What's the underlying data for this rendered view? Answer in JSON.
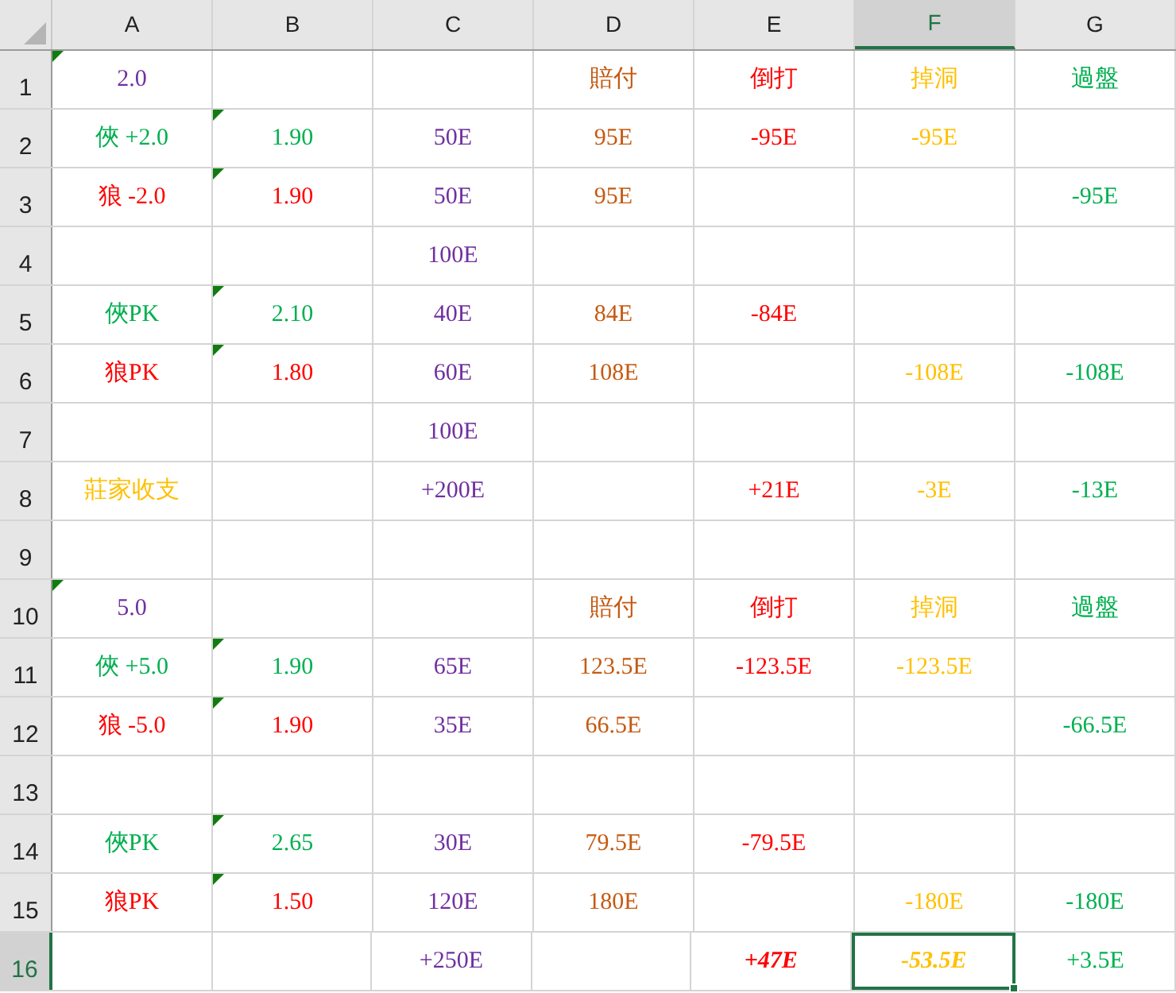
{
  "columns": [
    {
      "label": "A",
      "selected": false
    },
    {
      "label": "B",
      "selected": false
    },
    {
      "label": "C",
      "selected": false
    },
    {
      "label": "D",
      "selected": false
    },
    {
      "label": "E",
      "selected": false
    },
    {
      "label": "F",
      "selected": true
    },
    {
      "label": "G",
      "selected": false
    }
  ],
  "rows": [
    {
      "label": "1",
      "selected": false,
      "cells": [
        {
          "text": "2.0",
          "color": "#7030a0",
          "marker": true,
          "emphasis": false,
          "selected": false
        },
        {
          "marker": false,
          "selected": false
        },
        {
          "marker": false,
          "selected": false
        },
        {
          "text": "賠付",
          "color": "#c55a11",
          "marker": false,
          "emphasis": false,
          "selected": false
        },
        {
          "text": "倒打",
          "color": "#ff0000",
          "marker": false,
          "emphasis": false,
          "selected": false
        },
        {
          "text": "掉洞",
          "color": "#ffc000",
          "marker": false,
          "emphasis": false,
          "selected": false
        },
        {
          "text": "過盤",
          "color": "#00b050",
          "marker": false,
          "emphasis": false,
          "selected": false
        }
      ]
    },
    {
      "label": "2",
      "selected": false,
      "cells": [
        {
          "text": "俠 +2.0",
          "color": "#00b050",
          "marker": false,
          "emphasis": false,
          "selected": false
        },
        {
          "text": "1.90",
          "color": "#00b050",
          "marker": true,
          "emphasis": false,
          "selected": false
        },
        {
          "text": "50E",
          "color": "#7030a0",
          "marker": false,
          "emphasis": false,
          "selected": false
        },
        {
          "text": "95E",
          "color": "#c55a11",
          "marker": false,
          "emphasis": false,
          "selected": false
        },
        {
          "text": "-95E",
          "color": "#ff0000",
          "marker": false,
          "emphasis": false,
          "selected": false
        },
        {
          "text": "-95E",
          "color": "#ffc000",
          "marker": false,
          "emphasis": false,
          "selected": false
        },
        {
          "marker": false,
          "selected": false
        }
      ]
    },
    {
      "label": "3",
      "selected": false,
      "cells": [
        {
          "text": "狼 -2.0",
          "color": "#ff0000",
          "marker": false,
          "emphasis": false,
          "selected": false
        },
        {
          "text": "1.90",
          "color": "#ff0000",
          "marker": true,
          "emphasis": false,
          "selected": false
        },
        {
          "text": "50E",
          "color": "#7030a0",
          "marker": false,
          "emphasis": false,
          "selected": false
        },
        {
          "text": "95E",
          "color": "#c55a11",
          "marker": false,
          "emphasis": false,
          "selected": false
        },
        {
          "marker": false,
          "selected": false
        },
        {
          "marker": false,
          "selected": false
        },
        {
          "text": "-95E",
          "color": "#00b050",
          "marker": false,
          "emphasis": false,
          "selected": false
        }
      ]
    },
    {
      "label": "4",
      "selected": false,
      "cells": [
        {
          "marker": false,
          "selected": false
        },
        {
          "marker": false,
          "selected": false
        },
        {
          "text": "100E",
          "color": "#7030a0",
          "marker": false,
          "emphasis": false,
          "selected": false
        },
        {
          "marker": false,
          "selected": false
        },
        {
          "marker": false,
          "selected": false
        },
        {
          "marker": false,
          "selected": false
        },
        {
          "marker": false,
          "selected": false
        }
      ]
    },
    {
      "label": "5",
      "selected": false,
      "cells": [
        {
          "text": "俠PK",
          "color": "#00b050",
          "marker": false,
          "emphasis": false,
          "selected": false
        },
        {
          "text": "2.10",
          "color": "#00b050",
          "marker": true,
          "emphasis": false,
          "selected": false
        },
        {
          "text": "40E",
          "color": "#7030a0",
          "marker": false,
          "emphasis": false,
          "selected": false
        },
        {
          "text": "84E",
          "color": "#c55a11",
          "marker": false,
          "emphasis": false,
          "selected": false
        },
        {
          "text": "-84E",
          "color": "#ff0000",
          "marker": false,
          "emphasis": false,
          "selected": false
        },
        {
          "marker": false,
          "selected": false
        },
        {
          "marker": false,
          "selected": false
        }
      ]
    },
    {
      "label": "6",
      "selected": false,
      "cells": [
        {
          "text": "狼PK",
          "color": "#ff0000",
          "marker": false,
          "emphasis": false,
          "selected": false
        },
        {
          "text": "1.80",
          "color": "#ff0000",
          "marker": true,
          "emphasis": false,
          "selected": false
        },
        {
          "text": "60E",
          "color": "#7030a0",
          "marker": false,
          "emphasis": false,
          "selected": false
        },
        {
          "text": "108E",
          "color": "#c55a11",
          "marker": false,
          "emphasis": false,
          "selected": false
        },
        {
          "marker": false,
          "selected": false
        },
        {
          "text": "-108E",
          "color": "#ffc000",
          "marker": false,
          "emphasis": false,
          "selected": false
        },
        {
          "text": "-108E",
          "color": "#00b050",
          "marker": false,
          "emphasis": false,
          "selected": false
        }
      ]
    },
    {
      "label": "7",
      "selected": false,
      "cells": [
        {
          "marker": false,
          "selected": false
        },
        {
          "marker": false,
          "selected": false
        },
        {
          "text": "100E",
          "color": "#7030a0",
          "marker": false,
          "emphasis": false,
          "selected": false
        },
        {
          "marker": false,
          "selected": false
        },
        {
          "marker": false,
          "selected": false
        },
        {
          "marker": false,
          "selected": false
        },
        {
          "marker": false,
          "selected": false
        }
      ]
    },
    {
      "label": "8",
      "selected": false,
      "cells": [
        {
          "text": "莊家收支",
          "color": "#ffc000",
          "marker": false,
          "emphasis": false,
          "selected": false
        },
        {
          "marker": false,
          "selected": false
        },
        {
          "text": "+200E",
          "color": "#7030a0",
          "marker": false,
          "emphasis": false,
          "selected": false
        },
        {
          "marker": false,
          "selected": false
        },
        {
          "text": "+21E",
          "color": "#ff0000",
          "marker": false,
          "emphasis": false,
          "selected": false
        },
        {
          "text": "-3E",
          "color": "#ffc000",
          "marker": false,
          "emphasis": false,
          "selected": false
        },
        {
          "text": "-13E",
          "color": "#00b050",
          "marker": false,
          "emphasis": false,
          "selected": false
        }
      ]
    },
    {
      "label": "9",
      "selected": false,
      "cells": [
        {
          "marker": false,
          "selected": false
        },
        {
          "marker": false,
          "selected": false
        },
        {
          "marker": false,
          "selected": false
        },
        {
          "marker": false,
          "selected": false
        },
        {
          "marker": false,
          "selected": false
        },
        {
          "marker": false,
          "selected": false
        },
        {
          "marker": false,
          "selected": false
        }
      ]
    },
    {
      "label": "10",
      "selected": false,
      "cells": [
        {
          "text": "5.0",
          "color": "#7030a0",
          "marker": true,
          "emphasis": false,
          "selected": false
        },
        {
          "marker": false,
          "selected": false
        },
        {
          "marker": false,
          "selected": false
        },
        {
          "text": "賠付",
          "color": "#c55a11",
          "marker": false,
          "emphasis": false,
          "selected": false
        },
        {
          "text": "倒打",
          "color": "#ff0000",
          "marker": false,
          "emphasis": false,
          "selected": false
        },
        {
          "text": "掉洞",
          "color": "#ffc000",
          "marker": false,
          "emphasis": false,
          "selected": false
        },
        {
          "text": "過盤",
          "color": "#00b050",
          "marker": false,
          "emphasis": false,
          "selected": false
        }
      ]
    },
    {
      "label": "11",
      "selected": false,
      "cells": [
        {
          "text": "俠 +5.0",
          "color": "#00b050",
          "marker": false,
          "emphasis": false,
          "selected": false
        },
        {
          "text": "1.90",
          "color": "#00b050",
          "marker": true,
          "emphasis": false,
          "selected": false
        },
        {
          "text": "65E",
          "color": "#7030a0",
          "marker": false,
          "emphasis": false,
          "selected": false
        },
        {
          "text": "123.5E",
          "color": "#c55a11",
          "marker": false,
          "emphasis": false,
          "selected": false
        },
        {
          "text": "-123.5E",
          "color": "#ff0000",
          "marker": false,
          "emphasis": false,
          "selected": false
        },
        {
          "text": "-123.5E",
          "color": "#ffc000",
          "marker": false,
          "emphasis": false,
          "selected": false
        },
        {
          "marker": false,
          "selected": false
        }
      ]
    },
    {
      "label": "12",
      "selected": false,
      "cells": [
        {
          "text": "狼 -5.0",
          "color": "#ff0000",
          "marker": false,
          "emphasis": false,
          "selected": false
        },
        {
          "text": "1.90",
          "color": "#ff0000",
          "marker": true,
          "emphasis": false,
          "selected": false
        },
        {
          "text": "35E",
          "color": "#7030a0",
          "marker": false,
          "emphasis": false,
          "selected": false
        },
        {
          "text": "66.5E",
          "color": "#c55a11",
          "marker": false,
          "emphasis": false,
          "selected": false
        },
        {
          "marker": false,
          "selected": false
        },
        {
          "marker": false,
          "selected": false
        },
        {
          "text": "-66.5E",
          "color": "#00b050",
          "marker": false,
          "emphasis": false,
          "selected": false
        }
      ]
    },
    {
      "label": "13",
      "selected": false,
      "cells": [
        {
          "marker": false,
          "selected": false
        },
        {
          "marker": false,
          "selected": false
        },
        {
          "marker": false,
          "selected": false
        },
        {
          "marker": false,
          "selected": false
        },
        {
          "marker": false,
          "selected": false
        },
        {
          "marker": false,
          "selected": false
        },
        {
          "marker": false,
          "selected": false
        }
      ]
    },
    {
      "label": "14",
      "selected": false,
      "cells": [
        {
          "text": "俠PK",
          "color": "#00b050",
          "marker": false,
          "emphasis": false,
          "selected": false
        },
        {
          "text": "2.65",
          "color": "#00b050",
          "marker": true,
          "emphasis": false,
          "selected": false
        },
        {
          "text": "30E",
          "color": "#7030a0",
          "marker": false,
          "emphasis": false,
          "selected": false
        },
        {
          "text": "79.5E",
          "color": "#c55a11",
          "marker": false,
          "emphasis": false,
          "selected": false
        },
        {
          "text": "-79.5E",
          "color": "#ff0000",
          "marker": false,
          "emphasis": false,
          "selected": false
        },
        {
          "marker": false,
          "selected": false
        },
        {
          "marker": false,
          "selected": false
        }
      ]
    },
    {
      "label": "15",
      "selected": false,
      "cells": [
        {
          "text": "狼PK",
          "color": "#ff0000",
          "marker": false,
          "emphasis": false,
          "selected": false
        },
        {
          "text": "1.50",
          "color": "#ff0000",
          "marker": true,
          "emphasis": false,
          "selected": false
        },
        {
          "text": "120E",
          "color": "#7030a0",
          "marker": false,
          "emphasis": false,
          "selected": false
        },
        {
          "text": "180E",
          "color": "#c55a11",
          "marker": false,
          "emphasis": false,
          "selected": false
        },
        {
          "marker": false,
          "selected": false
        },
        {
          "text": "-180E",
          "color": "#ffc000",
          "marker": false,
          "emphasis": false,
          "selected": false
        },
        {
          "text": "-180E",
          "color": "#00b050",
          "marker": false,
          "emphasis": false,
          "selected": false
        }
      ]
    },
    {
      "label": "16",
      "selected": true,
      "cells": [
        {
          "marker": false,
          "selected": false
        },
        {
          "marker": false,
          "selected": false
        },
        {
          "text": "+250E",
          "color": "#7030a0",
          "marker": false,
          "emphasis": false,
          "selected": false
        },
        {
          "marker": false,
          "selected": false
        },
        {
          "text": "+47E",
          "color": "#ff0000",
          "marker": false,
          "emphasis": true,
          "selected": false
        },
        {
          "text": "-53.5E",
          "color": "#ffc000",
          "marker": false,
          "emphasis": true,
          "selected": true
        },
        {
          "text": "+3.5E",
          "color": "#00b050",
          "marker": false,
          "emphasis": false,
          "selected": false
        }
      ]
    }
  ]
}
